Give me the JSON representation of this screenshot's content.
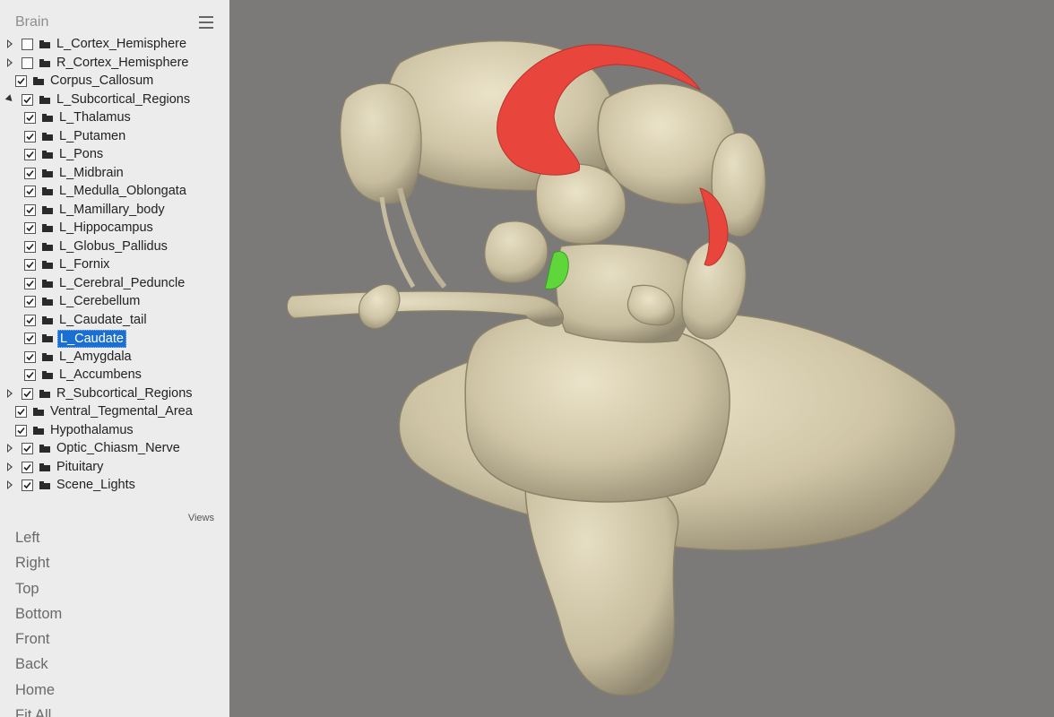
{
  "panel": {
    "title": "Brain",
    "menu_icon": "hamburger-menu-icon"
  },
  "tree": [
    {
      "label": "L_Cortex_Hemisphere",
      "level": 0,
      "expander": "collapsed",
      "checked": false
    },
    {
      "label": "R_Cortex_Hemisphere",
      "level": 0,
      "expander": "collapsed",
      "checked": false
    },
    {
      "label": "Corpus_Callosum",
      "level": 0,
      "expander": "none",
      "checked": true
    },
    {
      "label": "L_Subcortical_Regions",
      "level": 0,
      "expander": "expanded",
      "checked": true
    },
    {
      "label": "L_Thalamus",
      "level": 1,
      "expander": "none",
      "checked": true
    },
    {
      "label": "L_Putamen",
      "level": 1,
      "expander": "none",
      "checked": true
    },
    {
      "label": "L_Pons",
      "level": 1,
      "expander": "none",
      "checked": true
    },
    {
      "label": "L_Midbrain",
      "level": 1,
      "expander": "none",
      "checked": true
    },
    {
      "label": "L_Medulla_Oblongata",
      "level": 1,
      "expander": "none",
      "checked": true
    },
    {
      "label": "L_Mamillary_body",
      "level": 1,
      "expander": "none",
      "checked": true
    },
    {
      "label": "L_Hippocampus",
      "level": 1,
      "expander": "none",
      "checked": true
    },
    {
      "label": "L_Globus_Pallidus",
      "level": 1,
      "expander": "none",
      "checked": true
    },
    {
      "label": "L_Fornix",
      "level": 1,
      "expander": "none",
      "checked": true
    },
    {
      "label": "L_Cerebral_Peduncle",
      "level": 1,
      "expander": "none",
      "checked": true
    },
    {
      "label": "L_Cerebellum",
      "level": 1,
      "expander": "none",
      "checked": true
    },
    {
      "label": "L_Caudate_tail",
      "level": 1,
      "expander": "none",
      "checked": true
    },
    {
      "label": "L_Caudate",
      "level": 1,
      "expander": "none",
      "checked": true,
      "selected": true
    },
    {
      "label": "L_Amygdala",
      "level": 1,
      "expander": "none",
      "checked": true
    },
    {
      "label": "L_Accumbens",
      "level": 1,
      "expander": "none",
      "checked": true
    },
    {
      "label": "R_Subcortical_Regions",
      "level": 0,
      "expander": "collapsed",
      "checked": true
    },
    {
      "label": "Ventral_Tegmental_Area",
      "level": 0,
      "expander": "none",
      "checked": true
    },
    {
      "label": "Hypothalamus",
      "level": 0,
      "expander": "none",
      "checked": true
    },
    {
      "label": "Optic_Chiasm_Nerve",
      "level": 0,
      "expander": "collapsed",
      "checked": true
    },
    {
      "label": "Pituitary",
      "level": 0,
      "expander": "collapsed",
      "checked": true
    },
    {
      "label": "Scene_Lights",
      "level": 0,
      "expander": "collapsed",
      "checked": true
    }
  ],
  "views": {
    "label": "Views",
    "items": [
      "Left",
      "Right",
      "Top",
      "Bottom",
      "Front",
      "Back",
      "Home",
      "Fit All"
    ]
  },
  "colors": {
    "viewport_bg": "#7c7a79",
    "tissue": "#d2c9ae",
    "highlight_caudate": "#e8463c",
    "highlight_green": "#5fd63a",
    "selection": "#1a6fd0"
  }
}
